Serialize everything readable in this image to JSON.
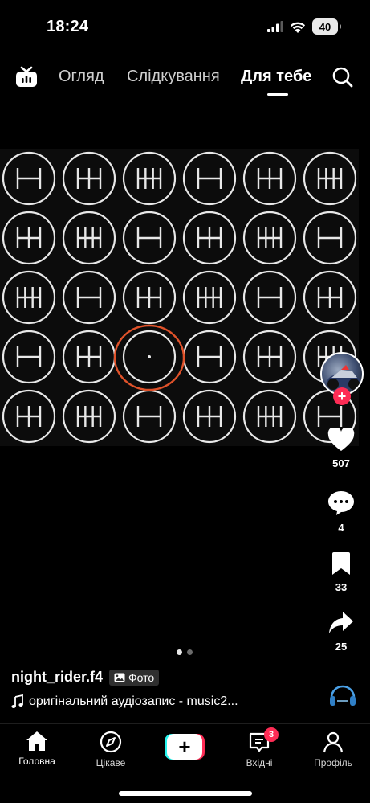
{
  "status_bar": {
    "time": "18:24",
    "battery": "40"
  },
  "top_nav": {
    "tabs": [
      {
        "label": "Огляд",
        "active": false
      },
      {
        "label": "Слідкування",
        "active": false
      },
      {
        "label": "Для тебе",
        "active": true
      }
    ],
    "icons": [
      "live-tv-icon",
      "search-icon"
    ]
  },
  "photo": {
    "description_icons": "gear-shift-pattern-diagrams",
    "grid_rows": 5,
    "grid_cols": 6,
    "highlight_color": "#e0522a"
  },
  "carousel": {
    "pages": 2,
    "current": 1
  },
  "post": {
    "username": "night_rider.f4",
    "badge_label": "Фото",
    "audio": "оригінальний аудіозапис - music2..."
  },
  "actions": {
    "likes": "507",
    "comments": "4",
    "saves": "33",
    "shares": "25"
  },
  "bottom_nav": {
    "items": [
      {
        "label": "Головна",
        "icon": "home-icon",
        "active": true
      },
      {
        "label": "Цікаве",
        "icon": "compass-icon",
        "active": false
      },
      {
        "label": "",
        "icon": "create-plus-icon",
        "active": false
      },
      {
        "label": "Вхідні",
        "icon": "inbox-icon",
        "active": false
      },
      {
        "label": "Профіль",
        "icon": "profile-icon",
        "active": false
      }
    ],
    "inbox_badge": "3"
  },
  "colors": {
    "accent": "#fe2c55",
    "accent_alt": "#25f4ee",
    "background": "#000000"
  }
}
